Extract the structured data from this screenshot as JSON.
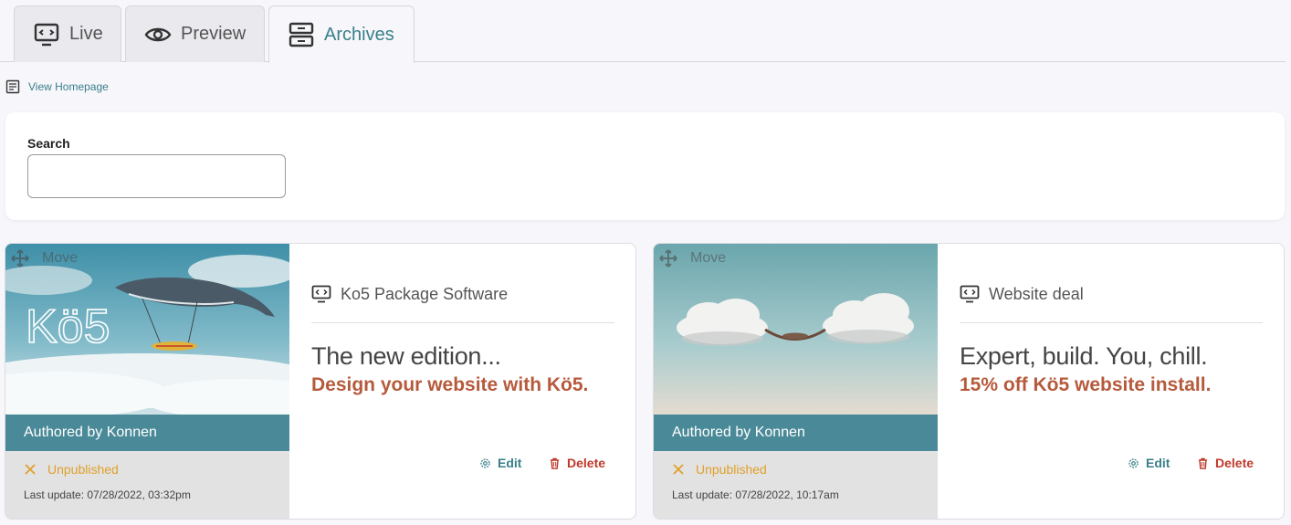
{
  "tabs": [
    {
      "label": "Live",
      "icon": "code-screen-icon"
    },
    {
      "label": "Preview",
      "icon": "eye-icon"
    },
    {
      "label": "Archives",
      "icon": "archive-icon"
    }
  ],
  "view_homepage": "View Homepage",
  "search": {
    "label": "Search",
    "value": "",
    "placeholder": ""
  },
  "cards": [
    {
      "move_label": "Move",
      "author": "Authored by Konnen",
      "status": "Unpublished",
      "last_update": "Last update: 07/28/2022, 03:32pm",
      "title": "Ko5 Package Software",
      "headline": "The new edition...",
      "subline": "Design your website with Kö5.",
      "edit_label": "Edit",
      "delete_label": "Delete",
      "image_logo_text": "Kö5"
    },
    {
      "move_label": "Move",
      "author": "Authored by Konnen",
      "status": "Unpublished",
      "last_update": "Last update: 07/28/2022, 10:17am",
      "title": "Website deal",
      "headline": "Expert, build. You, chill.",
      "subline": "15% off Kö5 website install.",
      "edit_label": "Edit",
      "delete_label": "Delete"
    }
  ],
  "colors": {
    "accent": "#3a8088",
    "author_bar": "#4a8a98",
    "status_unpublished": "#e0a02a",
    "subline": "#b65a3c",
    "delete": "#c0392b"
  }
}
